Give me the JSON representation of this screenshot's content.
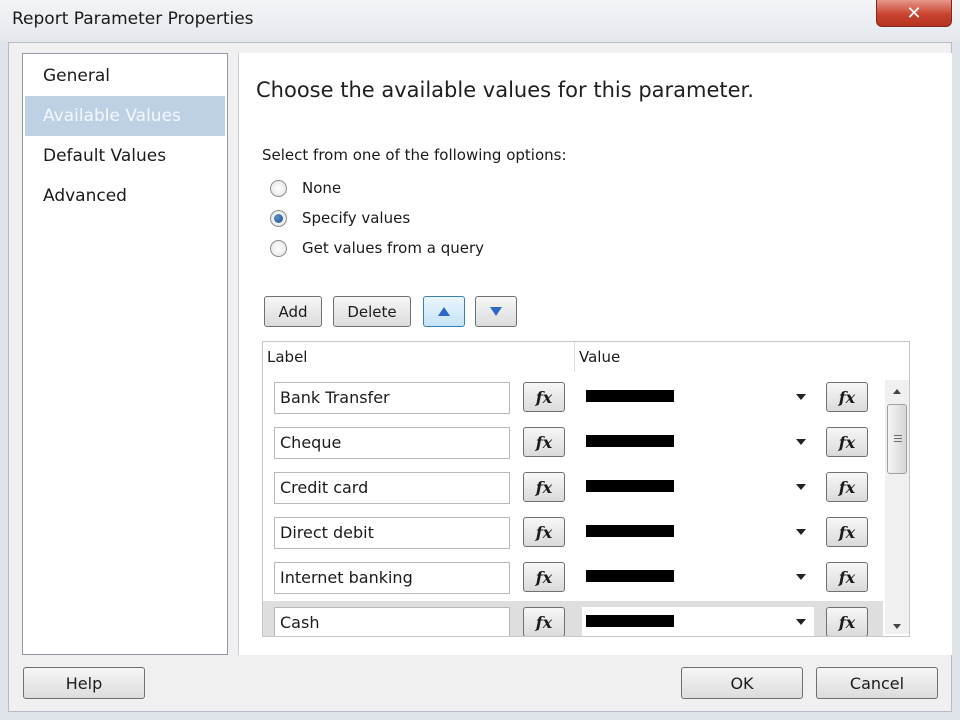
{
  "window": {
    "title": "Report Parameter Properties",
    "close_label": "✕"
  },
  "nav": {
    "items": [
      {
        "label": "General"
      },
      {
        "label": "Available Values"
      },
      {
        "label": "Default Values"
      },
      {
        "label": "Advanced"
      }
    ]
  },
  "main": {
    "heading": "Choose the available values for this parameter.",
    "options_prompt": "Select from one of the following options:",
    "options": [
      {
        "label": "None"
      },
      {
        "label": "Specify values"
      },
      {
        "label": "Get values from a query"
      }
    ],
    "toolbar": {
      "add_label": "Add",
      "delete_label": "Delete"
    }
  },
  "grid": {
    "headers": {
      "label": "Label",
      "value": "Value"
    },
    "rows": [
      {
        "label": "Bank Transfer"
      },
      {
        "label": "Cheque"
      },
      {
        "label": "Credit card"
      },
      {
        "label": "Direct debit"
      },
      {
        "label": "Internet banking"
      },
      {
        "label": "Cash"
      }
    ],
    "fx_label": "fx"
  },
  "footer": {
    "help_label": "Help",
    "ok_label": "OK",
    "cancel_label": "Cancel"
  }
}
